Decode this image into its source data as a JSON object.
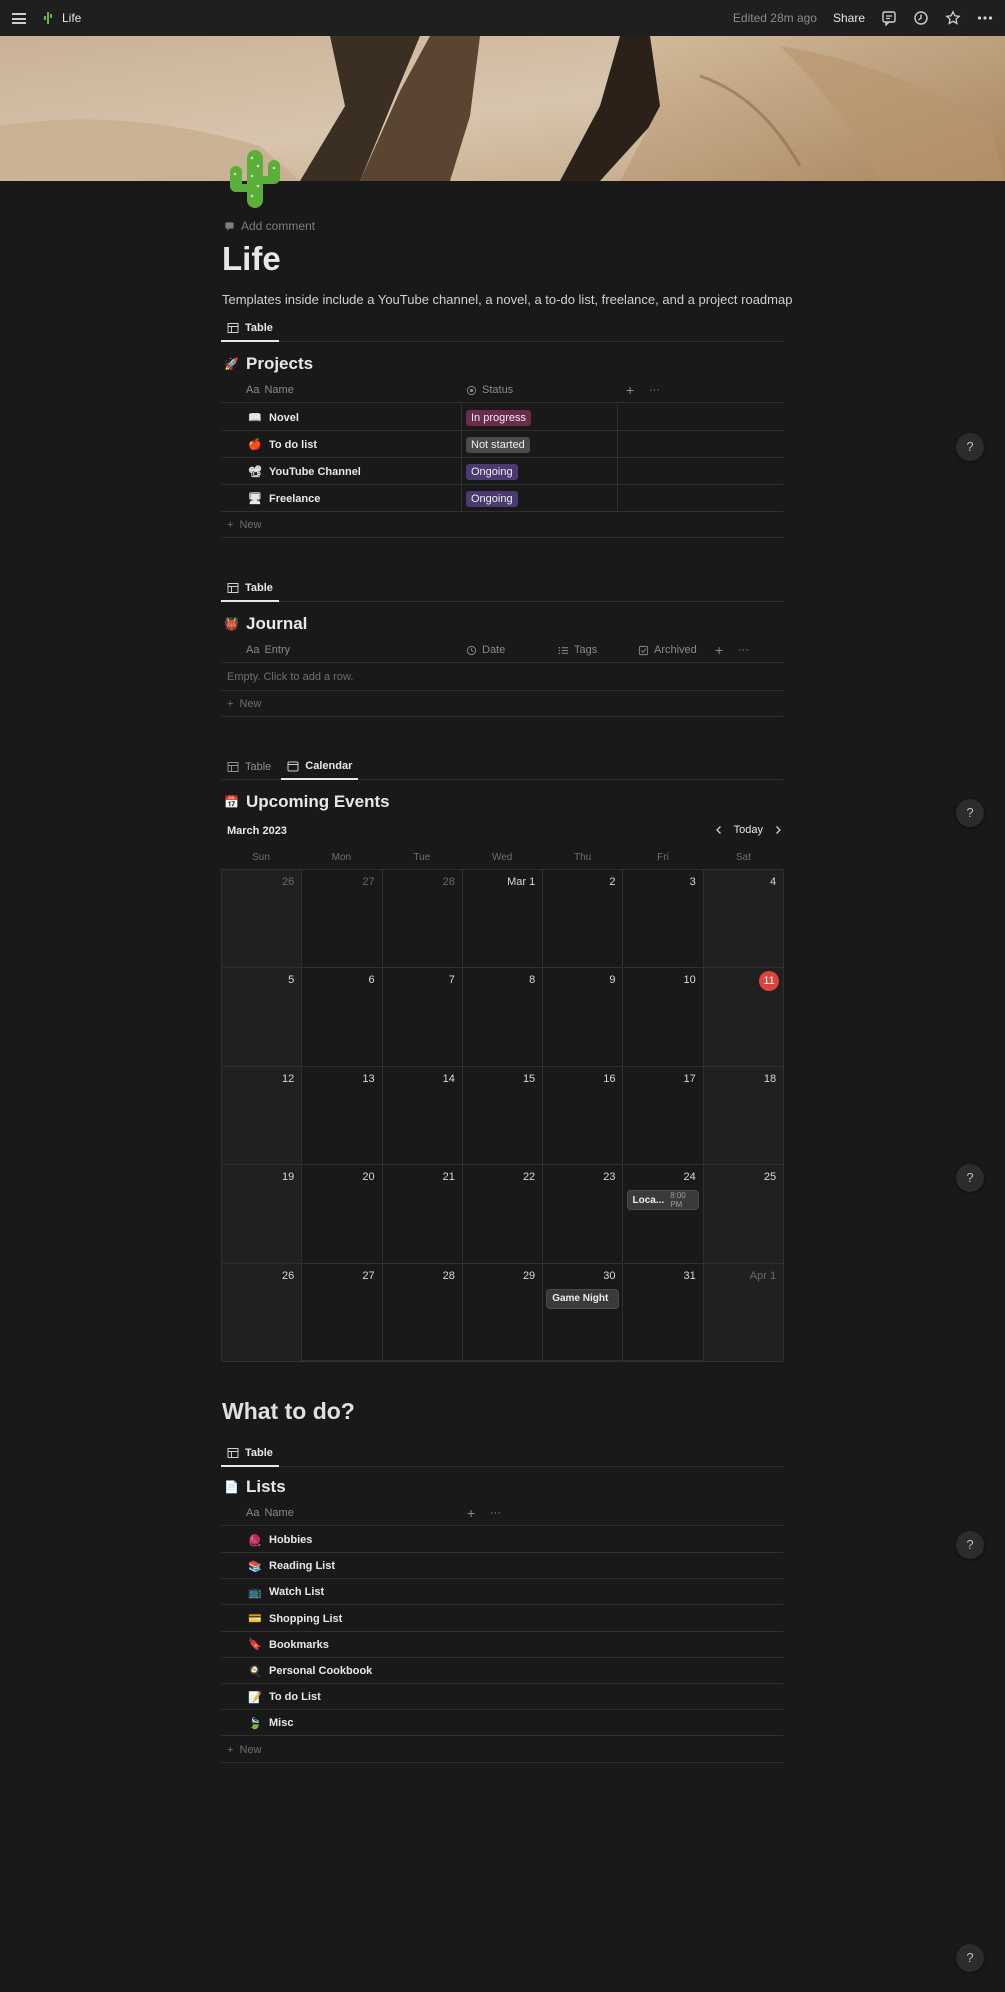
{
  "topbar": {
    "breadcrumb": "Life",
    "edited": "Edited 28m ago",
    "share": "Share",
    "icons": [
      "menu-icon",
      "cactus-icon",
      "comments-icon",
      "history-icon",
      "star-icon",
      "more-icon"
    ]
  },
  "page": {
    "add_comment": "Add comment",
    "title": "Life",
    "description": "Templates inside include a YouTube channel, a novel, a to-do list, freelance, and a project roadmap"
  },
  "projects": {
    "tab": "Table",
    "title": "Projects",
    "title_icon": "🚀",
    "columns": {
      "name_prefix": "Aa",
      "name": "Name",
      "status": "Status"
    },
    "rows": [
      {
        "icon": "📖",
        "name": "Novel",
        "status": "In progress",
        "status_color": "#6b2c4a"
      },
      {
        "icon": "🍎",
        "name": "To do list",
        "status": "Not started",
        "status_color": "#4a4a4a"
      },
      {
        "icon": "📽",
        "name": "YouTube Channel",
        "status": "Ongoing",
        "status_color": "#4b3a72"
      },
      {
        "icon": "🖥",
        "name": "Freelance",
        "status": "Ongoing",
        "status_color": "#4b3a72"
      }
    ],
    "new": "New"
  },
  "journal": {
    "tab": "Table",
    "title": "Journal",
    "title_icon": "👹",
    "columns": {
      "entry_prefix": "Aa",
      "entry": "Entry",
      "date": "Date",
      "tags": "Tags",
      "archived": "Archived"
    },
    "empty": "Empty. Click to add a row.",
    "new": "New"
  },
  "events": {
    "tabs": [
      "Table",
      "Calendar"
    ],
    "title": "Upcoming Events",
    "title_icon": "📅",
    "month": "March 2023",
    "today_label": "Today",
    "weekdays": [
      "Sun",
      "Mon",
      "Tue",
      "Wed",
      "Thu",
      "Fri",
      "Sat"
    ],
    "days": [
      "26",
      "27",
      "28",
      "Mar 1",
      "2",
      "3",
      "4",
      "5",
      "6",
      "7",
      "8",
      "9",
      "10",
      "11",
      "12",
      "13",
      "14",
      "15",
      "16",
      "17",
      "18",
      "19",
      "20",
      "21",
      "22",
      "23",
      "24",
      "25",
      "26",
      "27",
      "28",
      "29",
      "30",
      "31",
      "Apr 1"
    ],
    "today_index": 13,
    "dim_indices": [
      0,
      1,
      2,
      34
    ],
    "event_local": {
      "title": "Loca...",
      "time": "8:00 PM"
    },
    "event_game": {
      "title": "Game Night"
    }
  },
  "todo": {
    "heading": "What to do?",
    "tab": "Table",
    "title": "Lists",
    "title_icon": "📄",
    "columns": {
      "name_prefix": "Aa",
      "name": "Name"
    },
    "rows": [
      {
        "icon": "🧶",
        "name": "Hobbies"
      },
      {
        "icon": "📚",
        "name": "Reading List"
      },
      {
        "icon": "📺",
        "name": "Watch List"
      },
      {
        "icon": "💳",
        "name": "Shopping List"
      },
      {
        "icon": "🔖",
        "name": "Bookmarks"
      },
      {
        "icon": "🍳",
        "name": "Personal Cookbook"
      },
      {
        "icon": "📝",
        "name": "To do List"
      },
      {
        "icon": "🍃",
        "name": "Misc"
      }
    ],
    "new": "New"
  },
  "help": "?",
  "colors": {
    "background": "#191919",
    "topbar": "#1f1f1f",
    "today": "#d9453d",
    "border": "#2f2f2f"
  }
}
